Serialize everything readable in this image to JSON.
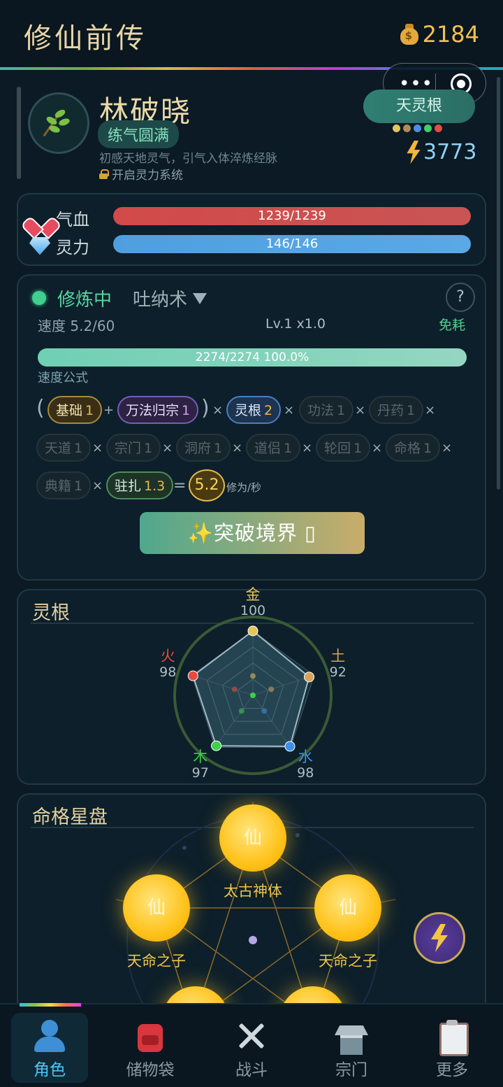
{
  "header": {
    "title": "修仙前传",
    "coins": "2184"
  },
  "profile": {
    "name": "林破晓",
    "realm": "练气圆满",
    "description": "初感天地灵气，引气入体淬炼经脉",
    "unlock_hint": "开启灵力系统",
    "root_type": "天灵根",
    "root_colors": [
      "#e6c35c",
      "#b08a5a",
      "#4a8fe0",
      "#3fcf6a",
      "#e84a3f"
    ],
    "combat_power": "3773"
  },
  "stats": {
    "hp_label": "气血",
    "hp_value": "1239/1239",
    "hp_fraction": 1.0,
    "mp_label": "灵力",
    "mp_value": "146/146",
    "mp_fraction": 1.0
  },
  "cultivation": {
    "status": "修炼中",
    "method": "吐纳术",
    "help": "?",
    "speed": "速度 5.2/60",
    "level": "Lv.1 x1.0",
    "cost": "免耗",
    "progress_text": "2274/2274  100.0%",
    "progress_fraction": 1.0,
    "formula_label": "速度公式",
    "factors": {
      "base": {
        "name": "基础",
        "value": "1"
      },
      "wanfa": {
        "name": "万法归宗",
        "value": "1"
      },
      "linggen": {
        "name": "灵根",
        "value": "2"
      },
      "gongfa": {
        "name": "功法",
        "value": "1"
      },
      "danyao": {
        "name": "丹药",
        "value": "1"
      },
      "tiandao": {
        "name": "天道",
        "value": "1"
      },
      "zongmen": {
        "name": "宗门",
        "value": "1"
      },
      "dongfu": {
        "name": "洞府",
        "value": "1"
      },
      "daolv": {
        "name": "道侣",
        "value": "1"
      },
      "lunhui": {
        "name": "轮回",
        "value": "1"
      },
      "mingge": {
        "name": "命格",
        "value": "1"
      },
      "dianji": {
        "name": "典籍",
        "value": "1"
      },
      "zhuzha": {
        "name": "驻扎",
        "value": "1.3"
      }
    },
    "result": "5.2",
    "unit": "修为/秒",
    "breakthrough": "✨突破境界 ▯"
  },
  "spirit_roots": {
    "title": "灵根",
    "elements": [
      {
        "name": "金",
        "value": "100",
        "color": "#e6c35c"
      },
      {
        "name": "土",
        "value": "92",
        "color": "#d9a45a"
      },
      {
        "name": "水",
        "value": "98",
        "color": "#3d8fe8"
      },
      {
        "name": "木",
        "value": "97",
        "color": "#3fcf4a"
      },
      {
        "name": "火",
        "value": "98",
        "color": "#e84a3f"
      }
    ]
  },
  "destiny": {
    "title": "命格星盘",
    "nodes": [
      {
        "glyph": "仙",
        "label": "太古神体"
      },
      {
        "glyph": "仙",
        "label": "天命之子"
      },
      {
        "glyph": "仙",
        "label": "天命之子"
      }
    ]
  },
  "nav": [
    {
      "label": "角色",
      "icon": "person-icon"
    },
    {
      "label": "储物袋",
      "icon": "bag-icon"
    },
    {
      "label": "战斗",
      "icon": "crossed-swords-icon"
    },
    {
      "label": "宗门",
      "icon": "temple-icon"
    },
    {
      "label": "更多",
      "icon": "clipboard-icon"
    }
  ]
}
